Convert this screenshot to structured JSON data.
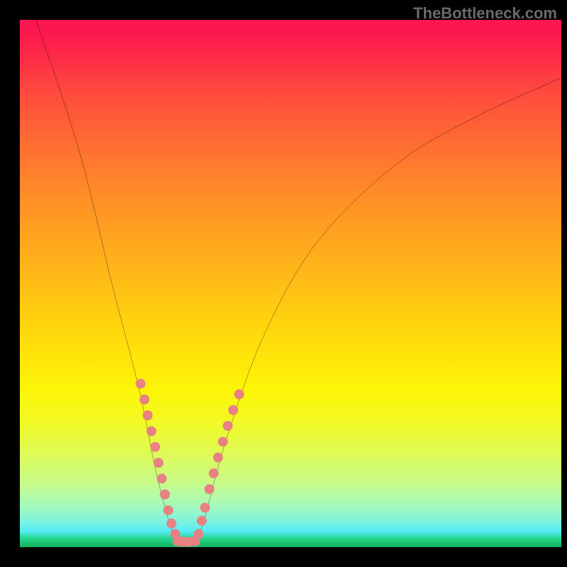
{
  "watermark": "TheBottleneck.com",
  "chart_data": {
    "type": "line",
    "title": "",
    "xlabel": "",
    "ylabel": "",
    "xlim": [
      0,
      100
    ],
    "ylim": [
      0,
      100
    ],
    "background_gradient": {
      "top_color": "#fc1750",
      "bottom_color": "#14b05e",
      "description": "red-to-green vertical gradient (red=bad, green=good)"
    },
    "series": [
      {
        "name": "left-curve",
        "type": "curve",
        "points": [
          {
            "x": 3,
            "y": 100
          },
          {
            "x": 11,
            "y": 75
          },
          {
            "x": 17,
            "y": 50
          },
          {
            "x": 22,
            "y": 30
          },
          {
            "x": 25,
            "y": 15
          },
          {
            "x": 27.5,
            "y": 5
          },
          {
            "x": 29,
            "y": 1
          }
        ]
      },
      {
        "name": "right-curve",
        "type": "curve",
        "points": [
          {
            "x": 32.5,
            "y": 1
          },
          {
            "x": 34,
            "y": 5
          },
          {
            "x": 38,
            "y": 20
          },
          {
            "x": 45,
            "y": 40
          },
          {
            "x": 55,
            "y": 58
          },
          {
            "x": 70,
            "y": 73
          },
          {
            "x": 85,
            "y": 82
          },
          {
            "x": 100,
            "y": 89
          }
        ]
      },
      {
        "name": "bottom-segment",
        "type": "line",
        "points": [
          {
            "x": 29,
            "y": 1
          },
          {
            "x": 32.5,
            "y": 1
          }
        ]
      }
    ],
    "dots_left": [
      {
        "x": 22.3,
        "y": 31
      },
      {
        "x": 23.0,
        "y": 28
      },
      {
        "x": 23.6,
        "y": 25
      },
      {
        "x": 24.3,
        "y": 22
      },
      {
        "x": 25.0,
        "y": 19
      },
      {
        "x": 25.6,
        "y": 16
      },
      {
        "x": 26.2,
        "y": 13
      },
      {
        "x": 26.8,
        "y": 10
      },
      {
        "x": 27.4,
        "y": 7
      },
      {
        "x": 28.0,
        "y": 4.5
      },
      {
        "x": 28.7,
        "y": 2.5
      }
    ],
    "dots_right": [
      {
        "x": 33.0,
        "y": 2.5
      },
      {
        "x": 33.6,
        "y": 5
      },
      {
        "x": 34.2,
        "y": 7.5
      },
      {
        "x": 35.0,
        "y": 11
      },
      {
        "x": 35.8,
        "y": 14
      },
      {
        "x": 36.6,
        "y": 17
      },
      {
        "x": 37.5,
        "y": 20
      },
      {
        "x": 38.4,
        "y": 23
      },
      {
        "x": 39.4,
        "y": 26
      },
      {
        "x": 40.5,
        "y": 29
      }
    ],
    "dots_bottom": [
      {
        "x": 29.3,
        "y": 1.2
      },
      {
        "x": 30.2,
        "y": 1.0
      },
      {
        "x": 31.1,
        "y": 1.0
      },
      {
        "x": 32.0,
        "y": 1.1
      }
    ],
    "dot_color": "#e88282",
    "dot_radius": 7
  }
}
